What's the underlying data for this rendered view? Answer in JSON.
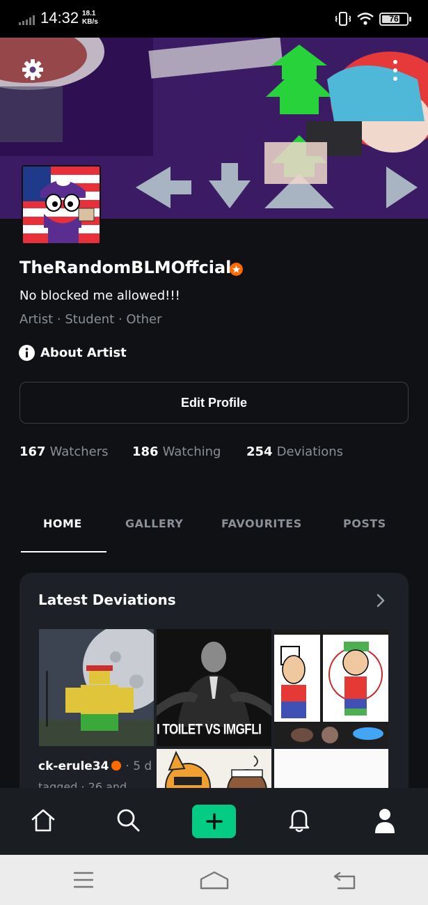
{
  "status_bar": {
    "time": "14:32",
    "net_speed_value": "18.1",
    "net_speed_unit": "KB/s",
    "battery": "76"
  },
  "banner": {
    "settings_icon": "gear-icon",
    "more_icon": "more-vertical-icon"
  },
  "profile": {
    "name": "TheRandomBLMOffcial",
    "bio": "No blocked me allowed!!!",
    "roles": "Artist · Student · Other",
    "about_label": "About Artist",
    "edit_label": "Edit Profile"
  },
  "stats": [
    {
      "value": "167",
      "label": "Watchers"
    },
    {
      "value": "186",
      "label": "Watching"
    },
    {
      "value": "254",
      "label": "Deviations"
    }
  ],
  "tabs": [
    {
      "label": "HOME",
      "active": true
    },
    {
      "label": "GALLERY",
      "active": false
    },
    {
      "label": "FAVOURITES",
      "active": false
    },
    {
      "label": "POSTS",
      "active": false
    }
  ],
  "latest": {
    "title": "Latest Deviations",
    "thumb2_caption": "I TOILET VS IMGFLI",
    "deviant_name": "ck-erule34",
    "deviant_when": "· 5 d",
    "tagged": "tagged · 26 and"
  },
  "bottom_nav": [
    "home-icon",
    "search-icon",
    "add-icon",
    "bell-icon",
    "profile-icon"
  ],
  "system_nav": [
    "menu-icon",
    "home-outline-icon",
    "back-icon"
  ],
  "colors": {
    "accent": "#05cc84",
    "badge": "#ff6a00",
    "background": "#0f1114",
    "card": "#1d2026"
  }
}
